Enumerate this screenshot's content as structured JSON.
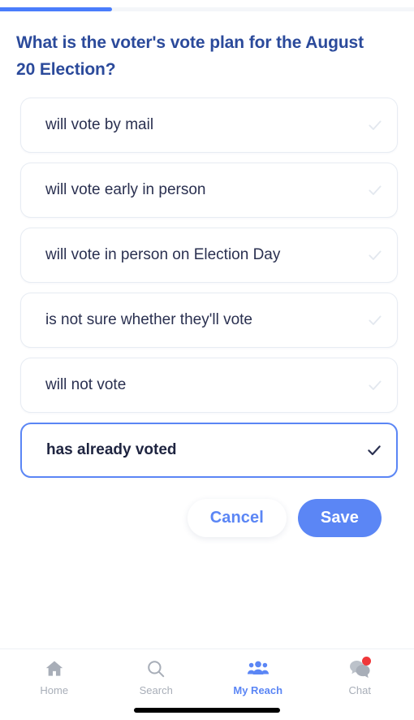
{
  "progress": {
    "percent": 27,
    "fill_color": "#4a7dfc",
    "track_color": "#f4f6f9"
  },
  "question": {
    "text": "What is the voter's vote plan for the August 20 Election?",
    "color": "#2b4a9b"
  },
  "options": [
    {
      "label": "will vote by mail",
      "selected": false,
      "check_icon": "check-icon"
    },
    {
      "label": "will vote early in person",
      "selected": false,
      "check_icon": "check-icon"
    },
    {
      "label": "will vote in person on Election Day",
      "selected": false,
      "check_icon": "check-icon"
    },
    {
      "label": "is not sure whether they'll vote",
      "selected": false,
      "check_icon": "check-icon"
    },
    {
      "label": "will not vote",
      "selected": false,
      "check_icon": "check-icon"
    },
    {
      "label": "has already voted",
      "selected": true,
      "check_icon": "check-icon"
    }
  ],
  "actions": {
    "cancel_label": "Cancel",
    "save_label": "Save",
    "cancel_color": "#5b86f5",
    "save_bg": "#5b86f5"
  },
  "bottom_nav": {
    "active_color": "#5b86f5",
    "inactive_color": "#a8aeb8",
    "badge_color": "#f0373a",
    "items": [
      {
        "label": "Home",
        "icon": "home-icon",
        "active": false,
        "badge": false
      },
      {
        "label": "Search",
        "icon": "search-icon",
        "active": false,
        "badge": false
      },
      {
        "label": "My Reach",
        "icon": "people-group-icon",
        "active": true,
        "badge": false
      },
      {
        "label": "Chat",
        "icon": "chat-bubbles-icon",
        "active": false,
        "badge": true
      }
    ]
  }
}
